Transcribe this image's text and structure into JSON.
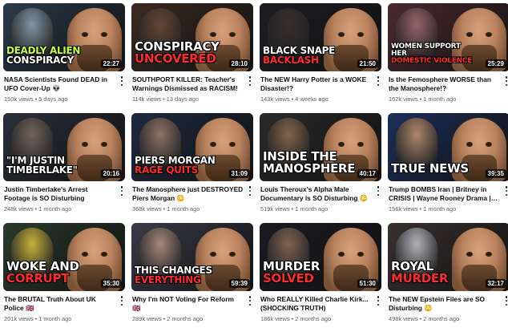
{
  "videos": [
    {
      "title": "NASA Scientists Found DEAD in UFO Cover-Up 👽",
      "views": "150k views",
      "age": "5 days ago",
      "duration": "22:27",
      "overlay": [
        "DEADLY ALIEN",
        "CONSPIRACY"
      ],
      "colors": [
        "#c6ff3c",
        "#ffffff"
      ],
      "bg": "#2b3a4a",
      "extra": "#8aa0b0"
    },
    {
      "title": "SOUTHPORT KILLER: Teacher's Warnings Dismissed as RACISM!",
      "views": "114k views",
      "age": "13 days ago",
      "duration": "28:10",
      "overlay": [
        "CONSPIRACY",
        "UNCOVERED"
      ],
      "colors": [
        "#ffffff",
        "#ff2a2a"
      ],
      "bg": "#3b2a20",
      "extra": "#6b4a3a"
    },
    {
      "title": "The NEW Harry Potter is a WOKE Disaster!?",
      "views": "143k views",
      "age": "4 weeks ago",
      "duration": "21:50",
      "overlay": [
        "BLACK SNAPE",
        "BACKLASH"
      ],
      "colors": [
        "#ffffff",
        "#ff2a2a"
      ],
      "bg": "#1d1d24",
      "extra": "#3a3030"
    },
    {
      "title": "Is the Femosphere WORSE than the Manosphere!?",
      "views": "162k views",
      "age": "1 month ago",
      "duration": "25:29",
      "overlay": [
        "WOMEN SUPPORT HER",
        "DOMESTIC VIOLENCE"
      ],
      "colors": [
        "#ffffff",
        "#ff2a2a"
      ],
      "bg": "#4a2a30",
      "extra": "#a06a70"
    },
    {
      "title": "Justin Timberlake's Arrest Footage is SO Disturbing",
      "views": "248k views",
      "age": "1 month ago",
      "duration": "20:16",
      "overlay": [
        "\"I'M JUSTIN",
        "TIMBERLAKE\""
      ],
      "colors": [
        "#ffffff",
        "#ffffff"
      ],
      "bg": "#2a2f3a",
      "extra": "#7a6a60"
    },
    {
      "title": "The Manosphere just DESTROYED Piers Morgan 😳",
      "views": "368k views",
      "age": "1 month ago",
      "duration": "31:09",
      "overlay": [
        "PIERS MORGAN",
        "RAGE QUITS"
      ],
      "colors": [
        "#ffffff",
        "#ff2a2a"
      ],
      "bg": "#1e2a40",
      "extra": "#9a7a68"
    },
    {
      "title": "Louis Theroux's Alpha Male Documentary is SO Disturbing 😳",
      "views": "519k views",
      "age": "1 month ago",
      "duration": "40:17",
      "overlay": [
        "INSIDE THE",
        "MANOSPHERE"
      ],
      "colors": [
        "#ffffff",
        "#ffffff"
      ],
      "bg": "#2a2a2a",
      "extra": "#8a6a50"
    },
    {
      "title": "Trump BOMBS Iran | Britney in CRISIS | Wayne Rooney Drama | Ian Huntley Dead",
      "views": "156k views",
      "age": "1 month ago",
      "duration": "39:35",
      "overlay": [
        "",
        "TRUE NEWS"
      ],
      "colors": [
        "#ffffff",
        "#ffffff"
      ],
      "bg": "#1c2e5a",
      "extra": "#c09070"
    },
    {
      "title": "The BRUTAL Truth About UK Police 🇬🇧",
      "views": "201k views",
      "age": "1 month ago",
      "duration": "35:30",
      "overlay": [
        "WOKE AND",
        "CORRUPT"
      ],
      "colors": [
        "#ffffff",
        "#ff2a2a"
      ],
      "bg": "#2a3a2a",
      "extra": "#d8c040"
    },
    {
      "title": "Why I'm NOT Voting For Reform 🇬🇧",
      "views": "289k views",
      "age": "2 months ago",
      "duration": "59:39",
      "overlay": [
        "THIS CHANGES",
        "EVERYTHING"
      ],
      "colors": [
        "#ffffff",
        "#ff2a2a"
      ],
      "bg": "#3a3a4a",
      "extra": "#b09080"
    },
    {
      "title": "Who REALLY Killed Charlie Kirk... (SHOCKING TRUTH)",
      "views": "186k views",
      "age": "2 months ago",
      "duration": "51:30",
      "overlay": [
        "MURDER",
        "SOLVED"
      ],
      "colors": [
        "#ffffff",
        "#ff2a2a"
      ],
      "bg": "#1a1a22",
      "extra": "#8a6a58"
    },
    {
      "title": "The NEW Epstein Files are SO Disturbing 😳",
      "views": "498k views",
      "age": "2 months ago",
      "duration": "32:17",
      "overlay": [
        "ROYAL",
        "MURDER"
      ],
      "colors": [
        "#ffffff",
        "#ff2a2a"
      ],
      "bg": "#3a3030",
      "extra": "#c0c0c8"
    }
  ],
  "separator": " • "
}
